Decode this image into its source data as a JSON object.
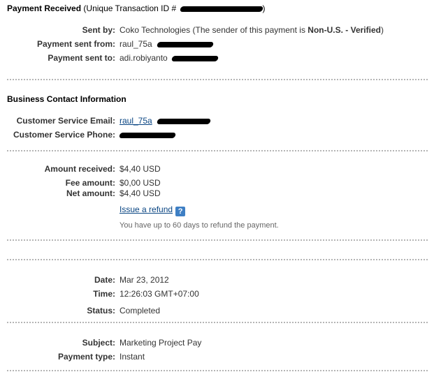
{
  "header": {
    "title": "Payment Received",
    "transaction_prefix": "(Unique Transaction ID #",
    "transaction_suffix": ")"
  },
  "sender": {
    "sent_by_label": "Sent by:",
    "sent_by_value": "Coko Technologies",
    "sent_by_note_prefix": "(The sender of this payment is ",
    "sent_by_note_status": "Non-U.S. - Verified",
    "sent_by_note_suffix": ")",
    "sent_from_label": "Payment sent from:",
    "sent_from_value": "raul_75a",
    "sent_to_label": "Payment sent to:",
    "sent_to_value": "adi.robiyanto"
  },
  "business": {
    "heading": "Business Contact Information",
    "email_label": "Customer Service Email:",
    "email_value": "raul_75a",
    "phone_label": "Customer Service Phone:"
  },
  "amounts": {
    "received_label": "Amount received:",
    "received_value": "$4,40 USD",
    "fee_label": "Fee amount:",
    "fee_value": "$0,00 USD",
    "net_label": "Net amount:",
    "net_value": "$4,40 USD",
    "refund_link": "Issue a refund",
    "help_icon_glyph": "?",
    "refund_hint": "You have up to 60 days to refund the payment."
  },
  "details": {
    "date_label": "Date:",
    "date_value": "Mar 23, 2012",
    "time_label": "Time:",
    "time_value": "12:26:03 GMT+07:00",
    "status_label": "Status:",
    "status_value": "Completed",
    "subject_label": "Subject:",
    "subject_value": "Marketing Project Pay",
    "type_label": "Payment type:",
    "type_value": "Instant"
  },
  "icons": {
    "help": "help-icon",
    "redaction": "redaction-scribble"
  },
  "colors": {
    "link": "#084482",
    "separator": "#b5b5b5",
    "help_icon": "#3e7fc4",
    "hint_text": "#666666"
  }
}
